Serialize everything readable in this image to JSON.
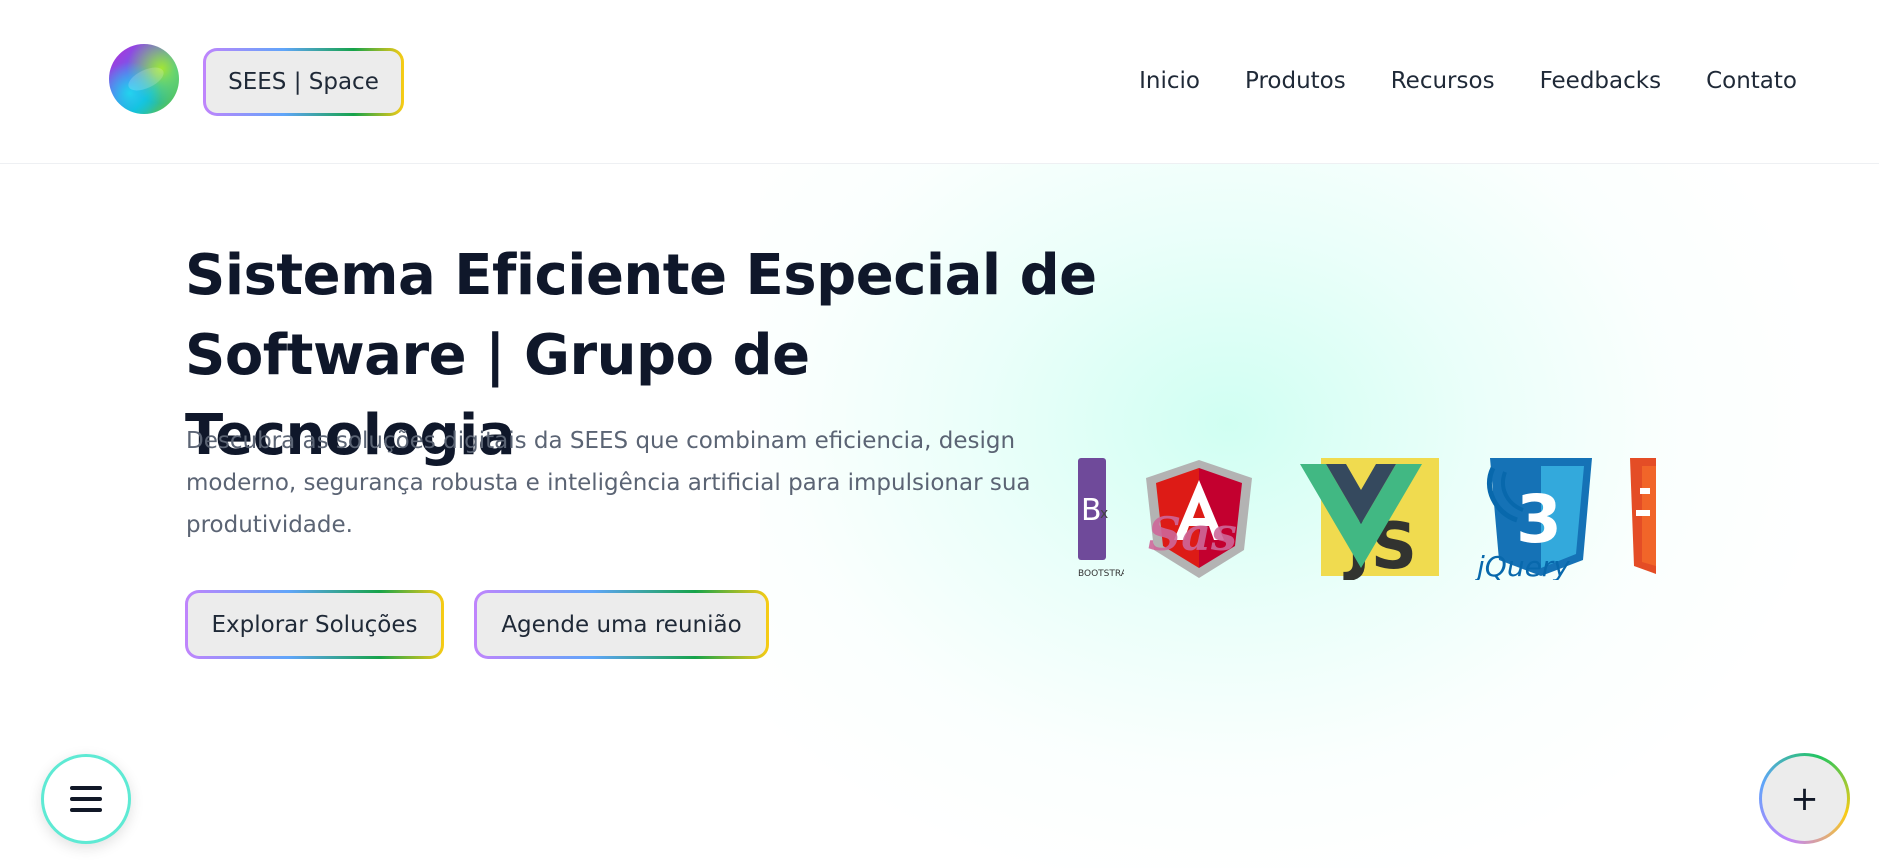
{
  "header": {
    "brand_label": "SEES | Space",
    "nav": [
      "Inicio",
      "Produtos",
      "Recursos",
      "Feedbacks",
      "Contato"
    ]
  },
  "hero": {
    "title_line1": "Sistema Eficiente Especial de",
    "title_line2": "Software | Grupo de Tecnologia",
    "description": "Descubra as soluções digitais da SEES que combinam eficiencia, design moderno, segurança robusta e inteligência artificial para impulsionar sua produtividade.",
    "primary_cta": "Explorar Soluções",
    "secondary_cta": "Agende uma reunião"
  },
  "tech_logos": [
    "bootstrap-logo",
    "sass-logo",
    "angular-logo",
    "vue-logo",
    "js-logo",
    "css3-logo",
    "jquery-logo",
    "html5-logo"
  ],
  "fabs": {
    "menu_icon": "menu-icon",
    "plus_symbol": "+"
  },
  "colors": {
    "title": "#0f172a",
    "text": "#5b6474",
    "button_bg": "#ececec",
    "gradient": [
      "#c084fc",
      "#60a5fa",
      "#16a34a",
      "#facc15"
    ],
    "menu_ring": "#5eead4"
  }
}
